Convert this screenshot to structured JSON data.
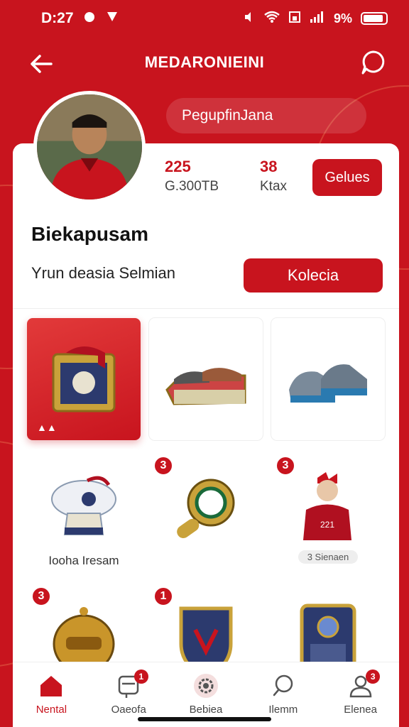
{
  "status_bar": {
    "time": "D:27",
    "battery_text": "9%",
    "battery_level": 0.9
  },
  "header": {
    "title": "MEDARONIEINI",
    "search_text": "PegupfinJana"
  },
  "profile": {
    "stat1_num": "225",
    "stat1_label": "G.300TB",
    "stat2_num": "38",
    "stat2_label": "Ktax",
    "follow_label": "Gelues",
    "name": "Biekapusam",
    "bio": "Yrun deasia  Selmian",
    "collect_label": "Kolecia"
  },
  "grid": [
    {
      "badge": "",
      "caption": "",
      "icon": "trophy-bag-icon"
    },
    {
      "badge": "",
      "caption": "",
      "icon": "shoes-box-icon"
    },
    {
      "badge": "",
      "caption": "",
      "icon": "sneakers-icon"
    },
    {
      "badge": "",
      "caption": "Iooha Iresam",
      "icon": "trophy-cup-icon"
    },
    {
      "badge": "3",
      "caption": "",
      "icon": "medal-ring-icon"
    },
    {
      "badge": "3",
      "caption": "3 Sienaen",
      "icon": "player-figure-icon"
    },
    {
      "badge": "3",
      "caption": "",
      "icon": "golden-helmet-icon"
    },
    {
      "badge": "1",
      "caption": "",
      "icon": "shield-badge-icon"
    },
    {
      "badge": "",
      "caption": "",
      "icon": "card-frame-icon"
    }
  ],
  "nav": [
    {
      "label": "Nental",
      "badge": "",
      "icon": "home-icon"
    },
    {
      "label": "Oaeofa",
      "badge": "1",
      "icon": "cart-icon"
    },
    {
      "label": "Bebiea",
      "badge": "",
      "icon": "gear-icon"
    },
    {
      "label": "Ilemm",
      "badge": "",
      "icon": "search-icon"
    },
    {
      "label": "Elenea",
      "badge": "3",
      "icon": "user-icon"
    }
  ],
  "colors": {
    "accent": "#c8141e",
    "background": "#c8141e"
  }
}
